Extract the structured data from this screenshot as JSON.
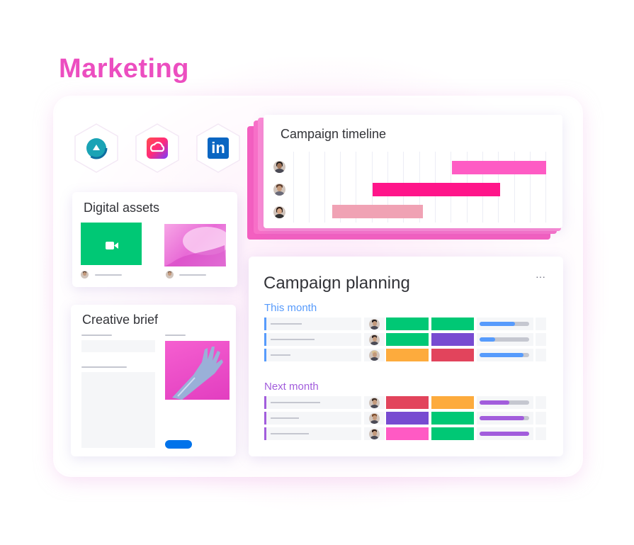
{
  "page": {
    "heading": "Marketing"
  },
  "integrations": [
    {
      "name": "campaign-app",
      "icon": "teal-circle-arrow-icon"
    },
    {
      "name": "adobe-creative-cloud",
      "icon": "adobe-cc-icon"
    },
    {
      "name": "linkedin",
      "icon": "linkedin-icon",
      "label": "in"
    }
  ],
  "digital_assets": {
    "title": "Digital assets",
    "video_icon": "video-camera-icon"
  },
  "creative_brief": {
    "title": "Creative brief"
  },
  "campaign_timeline": {
    "title": "Campaign timeline",
    "colors": [
      "#fe5bc4",
      "#ff158a",
      "#f0a2b4"
    ]
  },
  "campaign_planning": {
    "title": "Campaign planning",
    "menu_icon": "more-horizontal-icon",
    "menu_label": "···",
    "groups": [
      {
        "label": "This month",
        "color": "#579bfc",
        "rows": [
          {
            "status": "#00c875",
            "priority": "#00c875",
            "progress": 0.72,
            "progress_color": "#579bfc"
          },
          {
            "status": "#00c875",
            "priority": "#784bd1",
            "progress": 0.32,
            "progress_color": "#579bfc"
          },
          {
            "status": "#fdab3d",
            "priority": "#e2445c",
            "progress": 0.88,
            "progress_color": "#579bfc"
          }
        ]
      },
      {
        "label": "Next month",
        "color": "#a25ddc",
        "rows": [
          {
            "status": "#e2445c",
            "priority": "#fdab3d",
            "progress": 0.6,
            "progress_color": "#a25ddc"
          },
          {
            "status": "#784bd1",
            "priority": "#00c875",
            "progress": 0.9,
            "progress_color": "#a25ddc"
          },
          {
            "status": "#ff5ac4",
            "priority": "#00c875",
            "progress": 1.0,
            "progress_color": "#a25ddc"
          }
        ]
      }
    ]
  }
}
